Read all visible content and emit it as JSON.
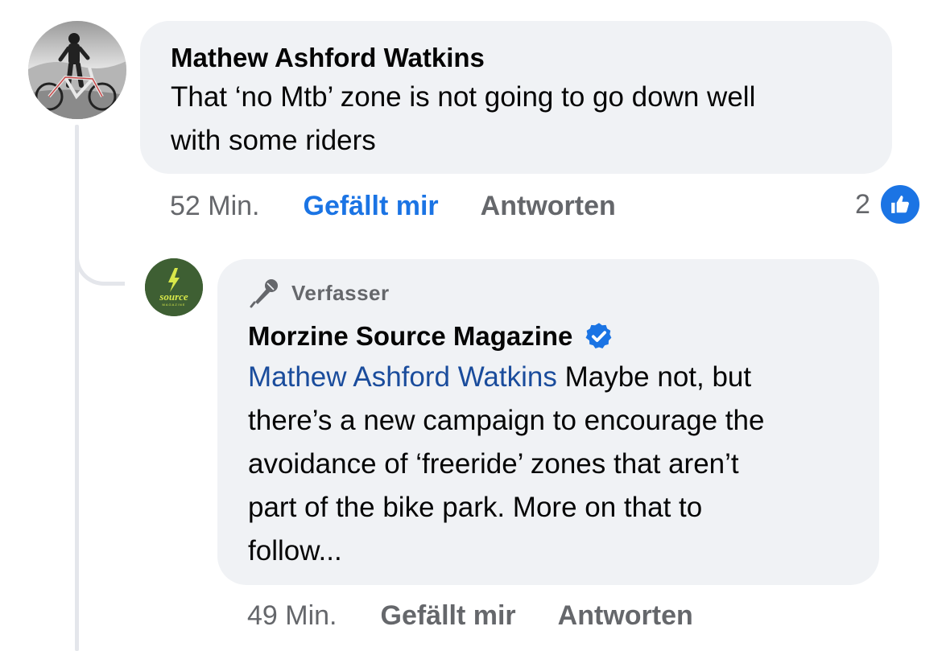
{
  "comment": {
    "author": "Mathew Ashford Watkins",
    "text_line1": "That ‘no Mtb’ zone is not going to go down well",
    "text_line2": "with some riders",
    "time": "52 Min.",
    "like_label": "Gefällt mir",
    "like_active": true,
    "reply_label": "Antworten",
    "reaction_count": "2",
    "reaction_icon": "thumbs-up-icon"
  },
  "reply": {
    "badge_icon": "microphone-icon",
    "badge": "Verfasser",
    "author": "Morzine Source Magazine",
    "verified_icon": "verified-badge-icon",
    "mention": "Mathew Ashford Watkins",
    "line1_rest": " Maybe not, but",
    "line2": "there’s a new campaign to encourage the",
    "line3": "avoidance of ‘freeride’ zones that aren’t",
    "line4": "part of the bike park. More on that to",
    "line5": "follow...",
    "time": "49 Min.",
    "like_label": "Gefällt mir",
    "reply_label": "Antworten",
    "avatar_logo": "source",
    "avatar_logo_sub": "MAGAZINE"
  },
  "colors": {
    "bubble": "#f0f2f5",
    "link_blue": "#1b74e4",
    "mention_blue": "#1a4c9c",
    "muted": "#65676b",
    "avatar_green": "#3e5f33",
    "logo_yellow": "#d8e84a"
  }
}
